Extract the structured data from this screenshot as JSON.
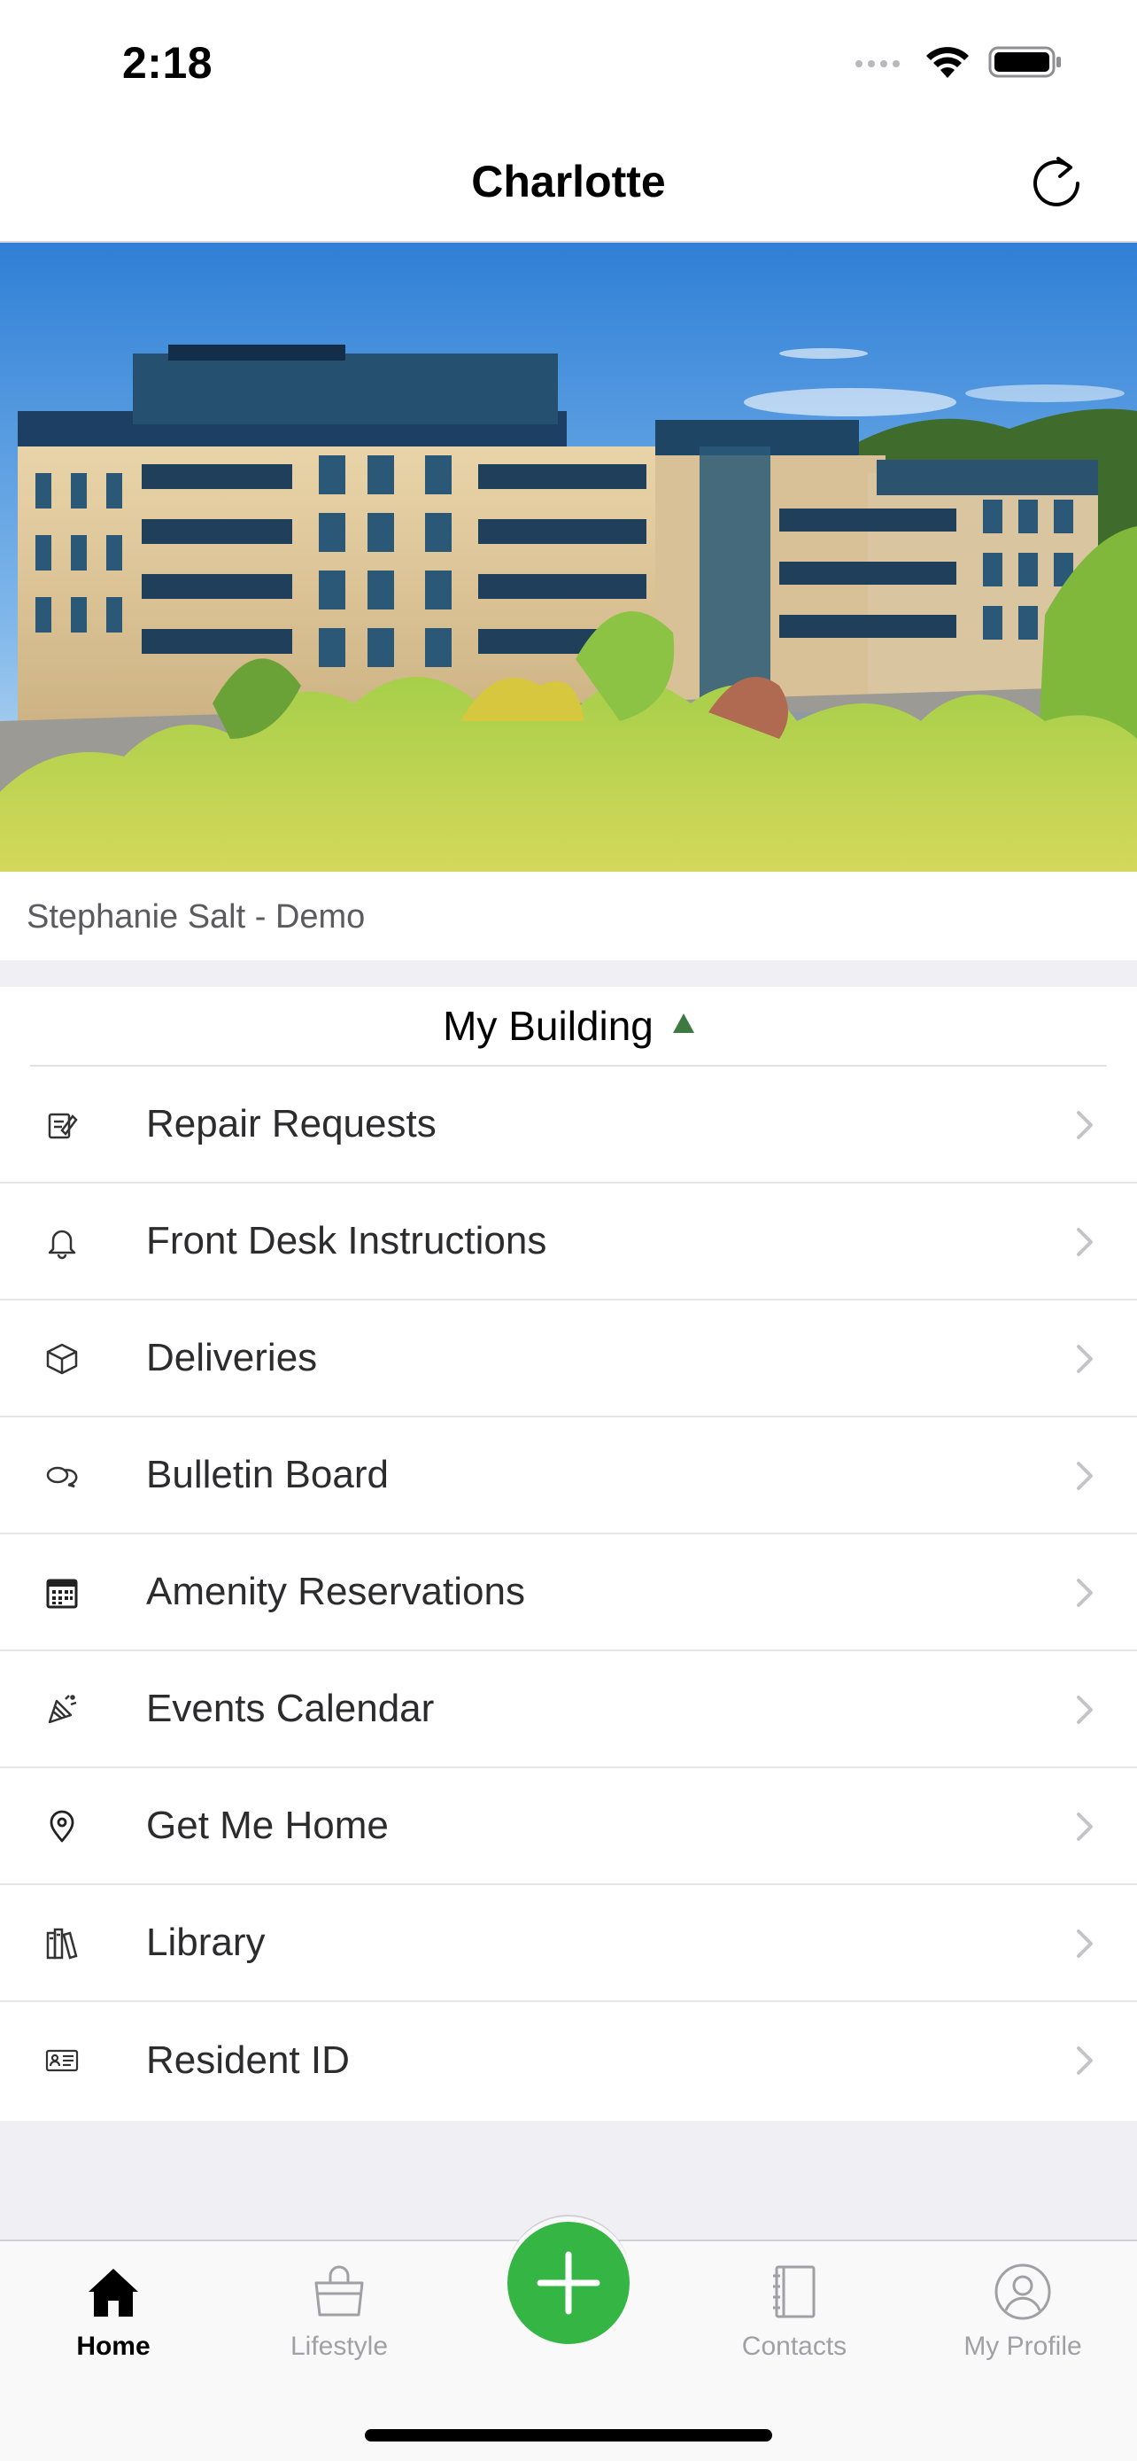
{
  "status_bar": {
    "time": "2:18"
  },
  "nav": {
    "title": "Charlotte",
    "refresh_icon": "refresh-icon"
  },
  "hero": {
    "image": "building-photo"
  },
  "user": {
    "name": "Stephanie Salt - Demo"
  },
  "section": {
    "title": "My Building",
    "expanded": true,
    "caret_color": "#3c7a3f"
  },
  "menu": {
    "items": [
      {
        "label": "Repair Requests",
        "icon": "repair-icon"
      },
      {
        "label": "Front Desk Instructions",
        "icon": "bell-icon"
      },
      {
        "label": "Deliveries",
        "icon": "package-icon"
      },
      {
        "label": "Bulletin Board",
        "icon": "chat-bubbles-icon"
      },
      {
        "label": "Amenity Reservations",
        "icon": "calendar-icon"
      },
      {
        "label": "Events Calendar",
        "icon": "party-icon"
      },
      {
        "label": "Get Me Home",
        "icon": "location-pin-icon"
      },
      {
        "label": "Library",
        "icon": "books-icon"
      },
      {
        "label": "Resident ID",
        "icon": "id-card-icon"
      }
    ]
  },
  "tab_bar": {
    "tabs": [
      {
        "label": "Home",
        "icon": "home-icon",
        "active": true
      },
      {
        "label": "Lifestyle",
        "icon": "shopping-bag-icon",
        "active": false
      },
      {
        "label": "Contacts",
        "icon": "contacts-book-icon",
        "active": false
      },
      {
        "label": "My Profile",
        "icon": "profile-icon",
        "active": false
      }
    ],
    "fab_icon": "plus-icon",
    "fab_color": "#34b544"
  }
}
